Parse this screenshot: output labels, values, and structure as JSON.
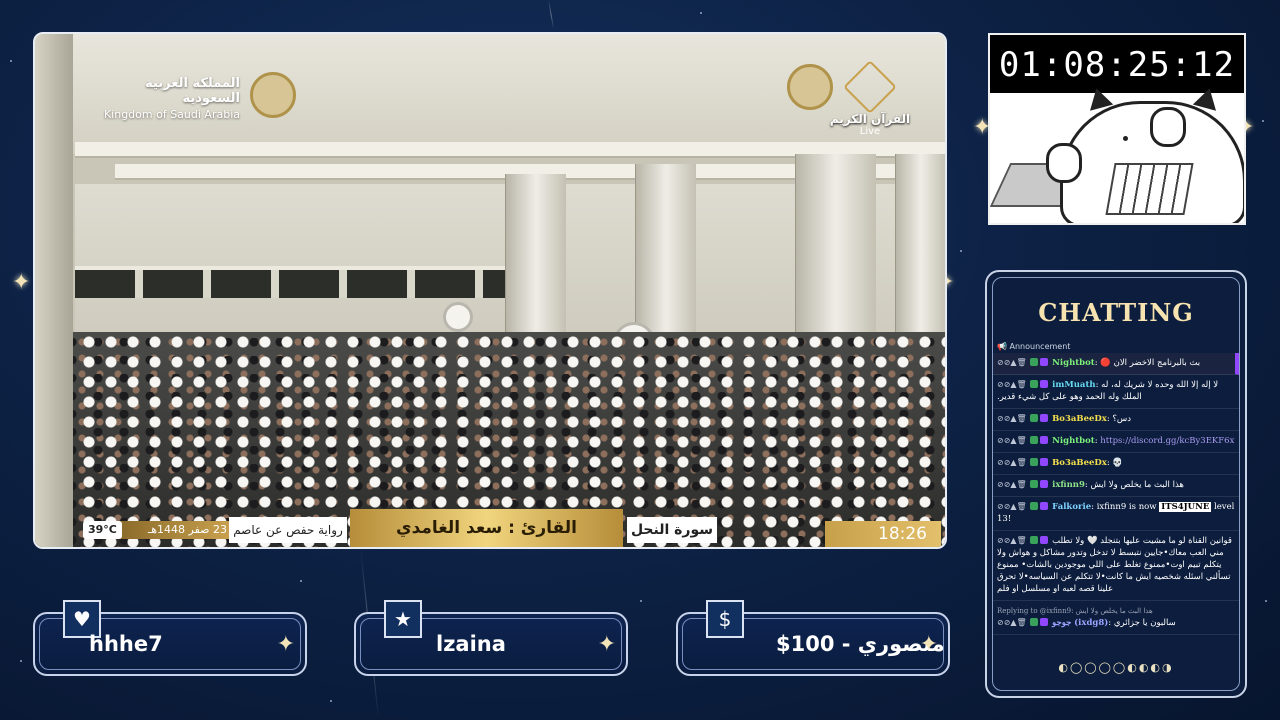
{
  "stream": {
    "logo_arabic": "المملكة العربية السعودية",
    "logo_english": "Kingdom of Saudi Arabia",
    "channel_name": "القرآن الكريم",
    "live_label": "Live",
    "temperature": "39°C",
    "hijri_date": "23 صفر 1448هـ",
    "riwaya": "رواية حفص عن عاصم",
    "qari": "القارئ : سعد الغامدي",
    "surah": "سورة النحل",
    "time": "18:26"
  },
  "timer": {
    "value": "01:08:25:12"
  },
  "chat": {
    "title": "CHATTING",
    "announcement": "Announcement",
    "messages": [
      {
        "user": "Nightbot",
        "user_color": "#7cf07a",
        "text": "بث بالبرنامج الاخضر الان 🔴",
        "pinned": true
      },
      {
        "user": "imMuath",
        "user_color": "#66d9ef",
        "text": "لا إله إلا الله وحده لا شريك له، له الملك وله الحمد وهو على كل شيء قدير."
      },
      {
        "user": "Bo3aBeeDx",
        "user_color": "#f4e04d",
        "text": "دس؟"
      },
      {
        "user": "Nightbot",
        "user_color": "#7cf07a",
        "text": "https://discord.gg/kcBy3EKF6x",
        "is_link": true
      },
      {
        "user": "Bo3aBeeDx",
        "user_color": "#f4e04d",
        "text": "💀"
      },
      {
        "user": "ixfinn9",
        "user_color": "#8fe388",
        "text": "هذا البث ما يخلص ولا ايش"
      },
      {
        "user": "Falkorie",
        "user_color": "#7fd3ff",
        "text_before": "ixfinn9 is now ",
        "highlight": "ITS4JUNE",
        "text_after": " level 13!"
      },
      {
        "user": "",
        "user_color": "#ffffff",
        "text": "قوانين القناة لو ما مشيت عليها بتنجلد 🤍 ولا تطلب مني العب معاك•جايين نتبسط لا تدخل وتدور مشاكل و هواش ولا يتكلم تبيم اوت•ممنوع تغلط على اللي موجودين بالشات• ممنوع تسألني اسئله شخصيه ايش ما كانت•لا تتكلم عن السياسه•لا تحرق علينا قصه لعبه او مسلسل او فلم"
      },
      {
        "reply_to": "Replying to @ixfinn9: هذا البث ما يخلص ولا ايش",
        "user": "جوجو",
        "user_handle": "(ixdg8)",
        "user_color": "#9aa5ff",
        "text": "سالبون يا جزائري"
      }
    ],
    "pager": "◐◯◯◯◯◐◐◐◑"
  },
  "info_boxes": [
    {
      "icon": "heart-icon",
      "glyph": "♥",
      "value": "hhhe7"
    },
    {
      "icon": "star-icon",
      "glyph": "★",
      "value": "lzaina"
    },
    {
      "icon": "dollar-icon",
      "glyph": "$",
      "value": "منصوري - 100$"
    }
  ]
}
